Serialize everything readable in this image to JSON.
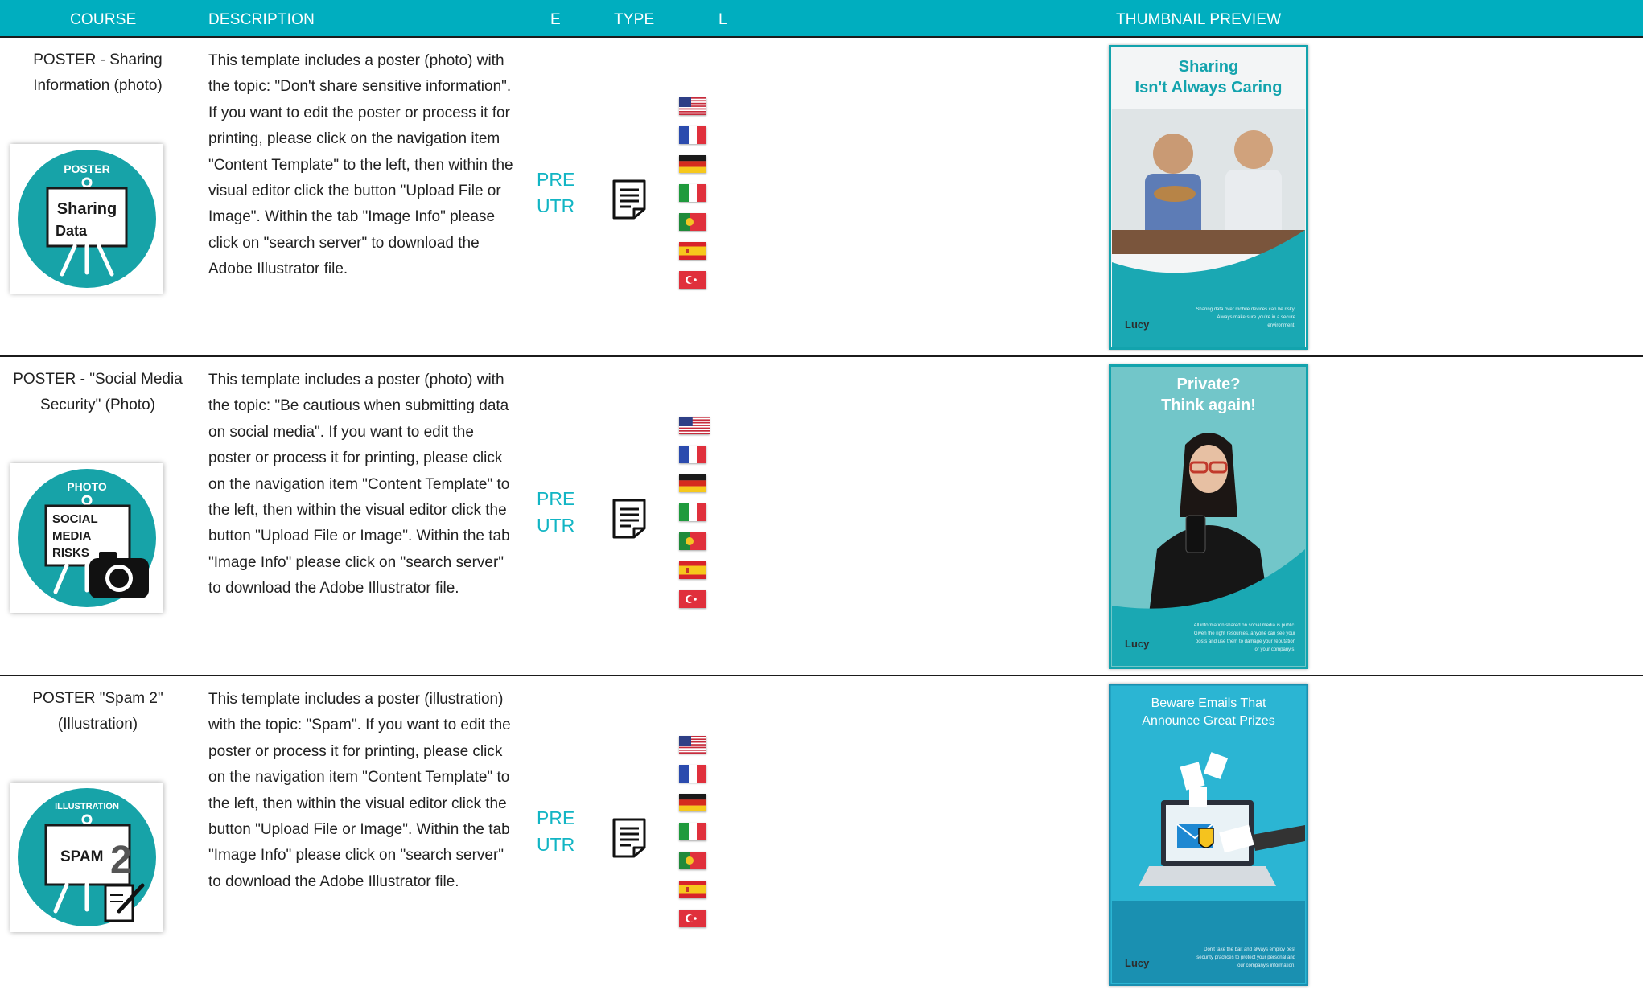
{
  "colors": {
    "header_bg": "#00aebf",
    "accent_text": "#12b5c4",
    "text": "#222222",
    "row_divider": "#1b1b1b"
  },
  "header": {
    "course": "COURSE",
    "description": "DESCRIPTION",
    "e": "E",
    "type": "TYPE",
    "l": "L",
    "thumbnail": "THUMBNAIL PREVIEW"
  },
  "rows": [
    {
      "course": "POSTER - Sharing Information (photo)",
      "icon": {
        "badge": "POSTER",
        "line1": "Sharing",
        "line2": "Data",
        "name": "poster-easel-icon"
      },
      "description": "This template includes a poster (photo) with the topic: \"Don't share sensitive information\". If you want to edit the poster or process it for printing, please click on the navigation item \"Content Template\" to the left, then within the visual editor click the button \"Upload File or Image\". Within the tab \"Image Info\" please click on \"search server\" to download the Adobe Illustrator file.",
      "e_line1": "PRE",
      "e_line2": "UTR",
      "type_icon": "document-icon",
      "languages": [
        "us-flag-icon",
        "france-flag-icon",
        "germany-flag-icon",
        "italy-flag-icon",
        "portugal-flag-icon",
        "spain-flag-icon",
        "turkey-flag-icon"
      ],
      "thumbnail": {
        "title": "Sharing\nIsn't Always Caring",
        "footer": "Sharing data over mobile devices can be risky. Always make sure you're in a secure environment.",
        "brand": "Lucy"
      }
    },
    {
      "course": "POSTER - \"Social Media Security\" (Photo)",
      "icon": {
        "badge": "PHOTO",
        "line1": "SOCIAL",
        "line2": "MEDIA",
        "line3": "RISKS",
        "name": "photo-poster-camera-icon"
      },
      "description": "This template includes a poster (photo) with the topic: \"Be cautious when submitting data on social media\". If you want to edit the poster or process it for printing, please click on the navigation item \"Content Template\" to the left, then within the visual editor click the button \"Upload File or Image\". Within the tab \"Image Info\" please click on \"search server\" to download the Adobe Illustrator file.",
      "e_line1": "PRE",
      "e_line2": "UTR",
      "type_icon": "document-icon",
      "languages": [
        "us-flag-icon",
        "france-flag-icon",
        "germany-flag-icon",
        "italy-flag-icon",
        "portugal-flag-icon",
        "spain-flag-icon",
        "turkey-flag-icon"
      ],
      "thumbnail": {
        "title": "Private?\nThink again!",
        "footer": "All information shared on social media is public. Given the right resources, anyone can see your posts and use them to damage your reputation or your company's.",
        "brand": "Lucy"
      }
    },
    {
      "course": "POSTER \"Spam 2\" (Illustration)",
      "icon": {
        "badge": "ILLUSTRATION",
        "line1": "SPAM",
        "line2": "2",
        "name": "illustration-poster-spam-icon"
      },
      "description": "This template includes a poster (illustration) with the topic: \"Spam\". If you want to edit the poster or process it for printing, please click on the navigation item \"Content Template\" to the left, then within the visual editor click the button \"Upload File or Image\". Within the tab \"Image Info\" please click on \"search server\" to download the Adobe Illustrator file.",
      "e_line1": "PRE",
      "e_line2": "UTR",
      "type_icon": "document-icon",
      "languages": [
        "us-flag-icon",
        "france-flag-icon",
        "germany-flag-icon",
        "italy-flag-icon",
        "portugal-flag-icon",
        "spain-flag-icon",
        "turkey-flag-icon"
      ],
      "thumbnail": {
        "title": "Beware Emails That\nAnnounce Great Prizes",
        "footer": "Don't take the bait and always employ best security practices to protect your personal and our company's information.",
        "brand": "Lucy"
      }
    }
  ]
}
